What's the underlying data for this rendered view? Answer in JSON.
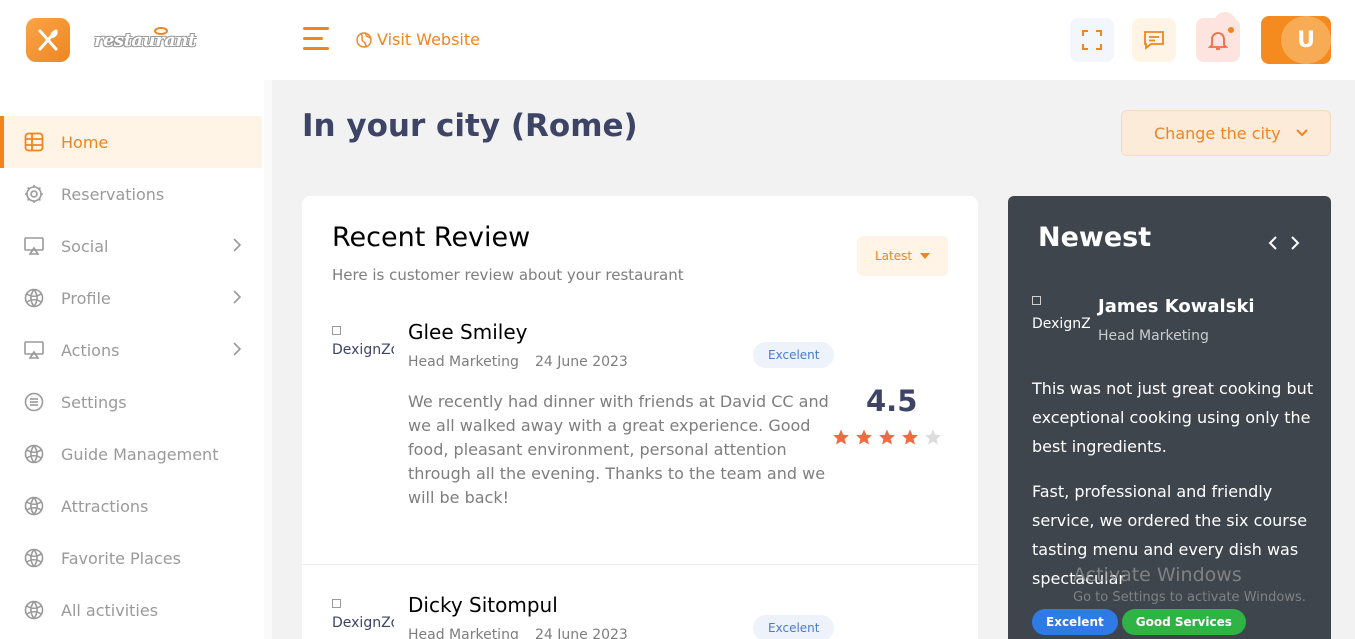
{
  "brand": {
    "name": "restaurant"
  },
  "sidebar": {
    "items": [
      {
        "label": "Home",
        "icon": "dashboard-icon",
        "active": true
      },
      {
        "label": "Reservations",
        "icon": "gear-icon"
      },
      {
        "label": "Social",
        "icon": "monitor-icon",
        "has_submenu": true
      },
      {
        "label": "Profile",
        "icon": "globe-icon",
        "has_submenu": true
      },
      {
        "label": "Actions",
        "icon": "monitor-icon",
        "has_submenu": true
      },
      {
        "label": "Settings",
        "icon": "list-icon"
      },
      {
        "label": "Guide Management",
        "icon": "globe-icon"
      },
      {
        "label": "Attractions",
        "icon": "globe-icon"
      },
      {
        "label": "Favorite Places",
        "icon": "globe-icon"
      },
      {
        "label": "All activities",
        "icon": "globe-icon"
      }
    ]
  },
  "header": {
    "visit_label": "Visit Website",
    "user_initial": "U"
  },
  "page": {
    "title": "In your city (Rome)",
    "city_button": "Change the city"
  },
  "recent_review": {
    "title": "Recent Review",
    "subtitle": "Here is customer review about your restaurant",
    "sort_label": "Latest",
    "reviews": [
      {
        "image_alt": "DexignZone",
        "name": "Glee Smiley",
        "role": "Head Marketing",
        "date": "24 June 2023",
        "badge": "Excelent",
        "text": "We recently had dinner with friends at David CC and we all walked away with a great experience. Good food, pleasant environment, personal attention through all the evening. Thanks to the team and we will be back!",
        "score": "4.5",
        "stars": 4,
        "max_stars": 5
      },
      {
        "image_alt": "DexignZone",
        "name": "Dicky Sitompul",
        "role": "Head Marketing",
        "date": "24 June 2023",
        "badge": "Excelent"
      }
    ]
  },
  "newest": {
    "title": "Newest",
    "image_alt": "DexignZone",
    "name": "James Kowalski",
    "role": "Head Marketing",
    "paragraph_1": "This was not just great cooking but exceptional cooking using only the best ingredients.",
    "paragraph_2": "Fast, professional and friendly service, we ordered the six course tasting menu and every dish was spectacular",
    "tags": [
      {
        "label": "Excelent",
        "color": "#2f7be5"
      },
      {
        "label": "Good Services",
        "color": "#2fb344"
      }
    ]
  },
  "watermark": {
    "title": "Activate Windows",
    "subtitle": "Go to Settings to activate Windows."
  },
  "colors": {
    "accent": "#f08520",
    "star_filled": "#f26a40",
    "star_empty": "#dcdcdc",
    "dark_card": "#3e454d"
  }
}
